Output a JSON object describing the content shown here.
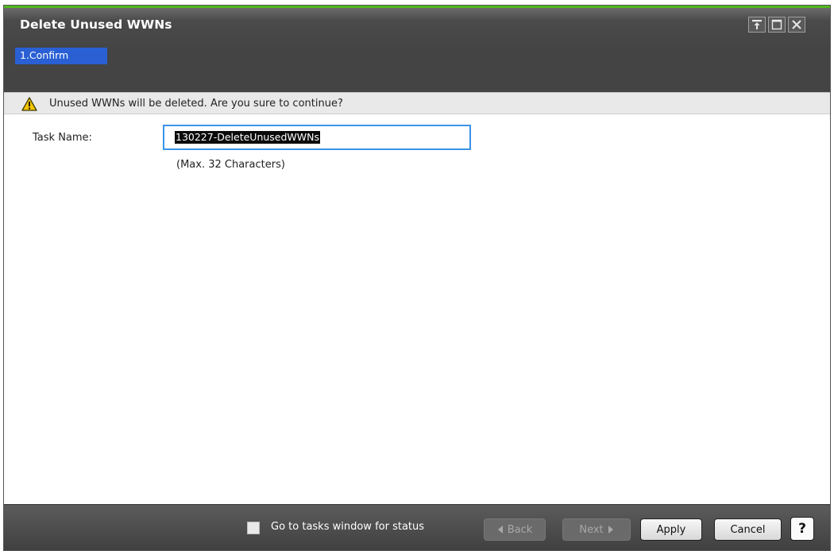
{
  "window": {
    "title": "Delete Unused WWNs",
    "controls": [
      "pin-icon",
      "maximize-icon",
      "close-icon"
    ]
  },
  "wizard": {
    "steps": [
      "1.Confirm"
    ],
    "current_step": "1.Confirm"
  },
  "warning": {
    "icon": "warning-icon",
    "message": "Unused WWNs will be deleted. Are you sure to continue?"
  },
  "form": {
    "task_name_label": "Task Name:",
    "task_name_value": "130227-DeleteUnusedWWNs",
    "task_name_hint": "(Max. 32 Characters)"
  },
  "footer": {
    "go_to_tasks_label": "Go to tasks window for status",
    "go_to_tasks_checked": false,
    "back_label": "Back",
    "next_label": "Next",
    "apply_label": "Apply",
    "cancel_label": "Cancel",
    "help_label": "?"
  },
  "colors": {
    "accent_line": "#4fb81d",
    "step_active": "#2a60d4",
    "input_focus": "#3a93e8",
    "warning": "#f5c400"
  }
}
